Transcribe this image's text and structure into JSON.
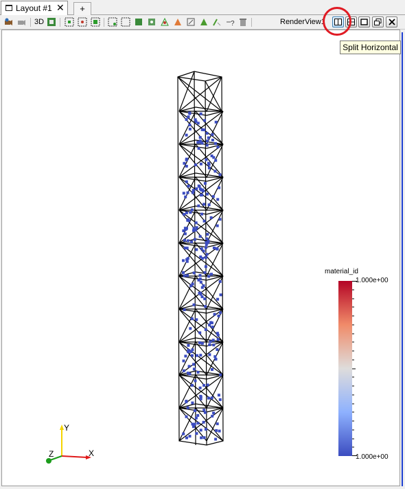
{
  "tabbar": {
    "tab_label": "Layout #1",
    "close_glyph": "✕",
    "new_tab_glyph": "+"
  },
  "toolbar": {
    "mode_label": "3D",
    "view_title": "RenderView1",
    "icons": [
      "reset-camera-icon",
      "reset-camera-closest-icon",
      "selection-display-icon",
      "select-cells-on-icon",
      "select-points-on-icon",
      "select-cells-through-icon",
      "select-points-through-icon",
      "select-block-icon",
      "interactive-select-cells-icon",
      "interactive-select-points-icon",
      "hover-points-icon",
      "hover-cells-icon",
      "grow-selection-icon",
      "shrink-selection-icon",
      "query-selection-icon",
      "clear-selection-icon"
    ]
  },
  "view_buttons": [
    "split-horizontal-icon",
    "split-vertical-icon",
    "maximize-icon",
    "restore-icon",
    "close-icon"
  ],
  "tooltip": {
    "text": "Split Horizontal"
  },
  "colorbar": {
    "title": "material_id",
    "max_label": "1.000e+00",
    "min_label": "1.000e+00",
    "colors": [
      "#b40426",
      "#f08b69",
      "#dedcdb",
      "#8eb1fe",
      "#3b4cc0"
    ]
  },
  "axes": {
    "x": "X",
    "y": "Y",
    "z": "Z"
  },
  "colors": {
    "annotation": "#e01b24",
    "points": "#3b4cc0",
    "mesh": "#000000"
  }
}
